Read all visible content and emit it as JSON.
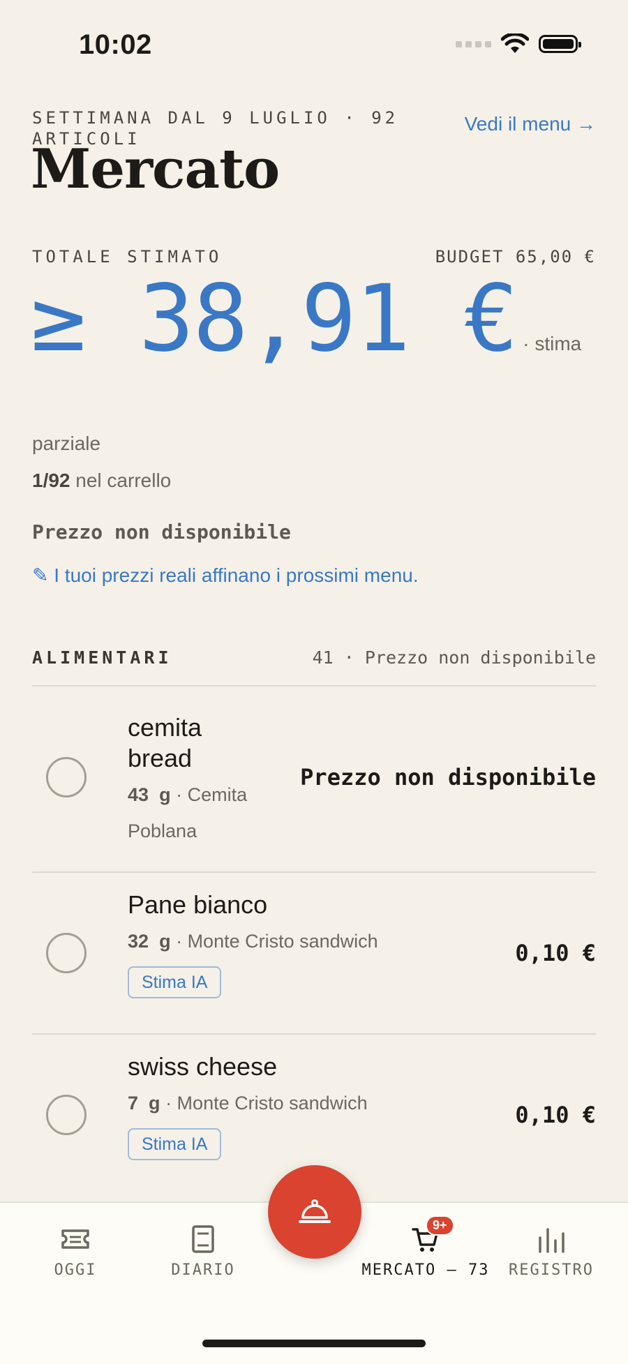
{
  "status_bar": {
    "time": "10:02"
  },
  "header": {
    "week": "SETTIMANA DAL 9 LUGLIO · 92 ARTICOLI",
    "menu_link": "Vedi il menu →",
    "title": "Mercato"
  },
  "totals": {
    "label": "TOTALE STIMATO",
    "budget": "BUDGET 65,00 €",
    "amount": "≥ 38,91 €",
    "note": "· stima",
    "partial": "parziale",
    "cart_count": "1/92",
    "cart_text": "nel carrello",
    "unavailable": "Prezzo non disponibile",
    "refine": "✎ I tuoi prezzi reali affinano i prossimi menu."
  },
  "section": {
    "name": "ALIMENTARI",
    "count": "41 · Prezzo non disponibile"
  },
  "items": [
    {
      "name_line1": "cemita",
      "name_line2": "bread",
      "qty": "43",
      "unit": "g",
      "meta_line1": "· Cemita",
      "meta_line2": "Poblana",
      "price": "Prezzo non disponibile"
    },
    {
      "name": "Pane bianco",
      "qty": "32",
      "unit": "g",
      "meta": "· Monte Cristo sandwich",
      "price": "0,10 €",
      "badge": "Stima IA"
    },
    {
      "name": "swiss cheese",
      "qty": "7",
      "unit": "g",
      "meta": "· Monte Cristo sandwich",
      "price": "0,10 €",
      "badge": "Stima IA"
    }
  ],
  "tabs": [
    {
      "label": "OGGI"
    },
    {
      "label": "DIARIO"
    },
    {
      "label": "MERCATO — 73",
      "badge": "9+"
    },
    {
      "label": "REGISTRO"
    }
  ],
  "colors": {
    "accent": "#3a78c5",
    "fab": "#d9432f",
    "background": "#f5f1e9"
  }
}
